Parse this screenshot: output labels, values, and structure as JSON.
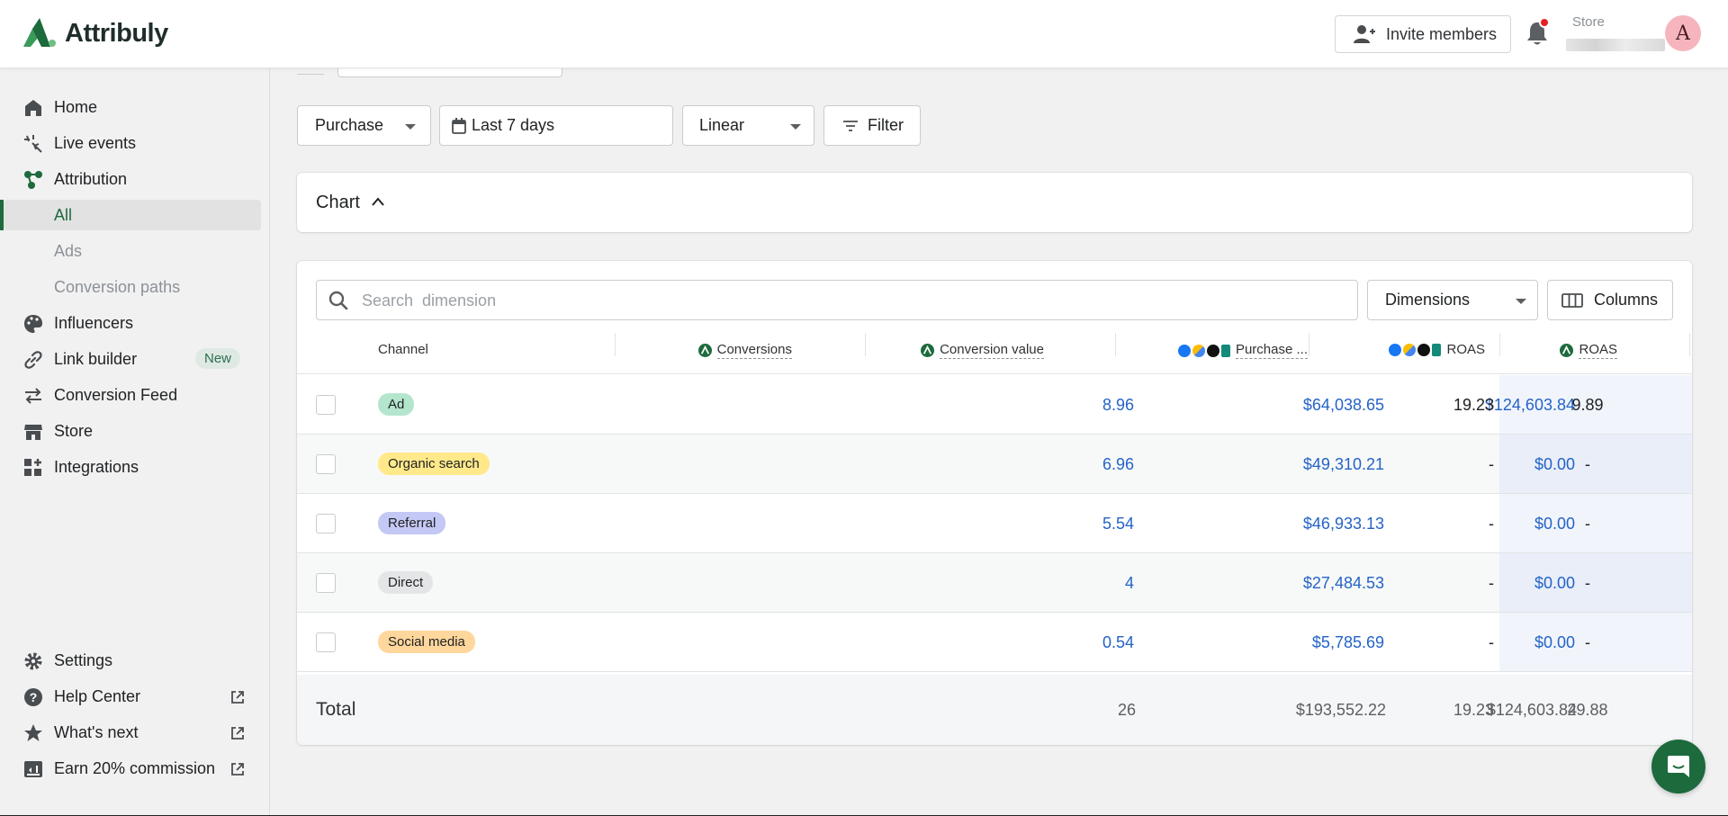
{
  "app": {
    "name": "Attribuly",
    "brand_color": "#1d6a3d"
  },
  "header": {
    "invite_label": "Invite members",
    "store_label": "Store",
    "avatar_letter": "A"
  },
  "sidebar": {
    "items": [
      {
        "label": "Home",
        "icon": "home-icon"
      },
      {
        "label": "Live events",
        "icon": "sparkle-icon"
      },
      {
        "label": "Attribution",
        "icon": "network-icon"
      },
      {
        "label": "All",
        "active": true
      },
      {
        "label": "Ads"
      },
      {
        "label": "Conversion paths"
      },
      {
        "label": "Influencers",
        "icon": "palette-icon"
      },
      {
        "label": "Link builder",
        "icon": "link-icon",
        "badge": "New"
      },
      {
        "label": "Conversion Feed",
        "icon": "arrows-icon"
      },
      {
        "label": "Store",
        "icon": "store-icon"
      },
      {
        "label": "Integrations",
        "icon": "grid-plus-icon"
      }
    ],
    "bottom": [
      {
        "label": "Settings",
        "icon": "gear-icon"
      },
      {
        "label": "Help Center",
        "icon": "help-icon",
        "external": true
      },
      {
        "label": "What's next",
        "icon": "star-icon",
        "external": true
      },
      {
        "label": "Earn 20% commission",
        "icon": "gift-icon",
        "external": true
      }
    ]
  },
  "filters": {
    "event": "Purchase",
    "date_range": "Last 7 days",
    "model": "Linear",
    "filter_label": "Filter"
  },
  "chart_section": {
    "title": "Chart"
  },
  "table": {
    "search_placeholder": "Search  dimension",
    "dimensions_label": "Dimensions",
    "columns_label": "Columns",
    "headers": {
      "channel": "Channel",
      "conversions": "Conversions",
      "conversion_value": "Conversion value",
      "purchase": "Purchase ...",
      "roas_platform": "ROAS",
      "roas": "ROAS"
    },
    "rows": [
      {
        "channel": "Ad",
        "pill_color": "#b4e6cd",
        "conversions": "8.96",
        "conversion_value": "$64,038.65",
        "purchase": "$124,603.84",
        "roas_platform": "19.23",
        "roas": "9.89"
      },
      {
        "channel": "Organic search",
        "pill_color": "#ffe98a",
        "conversions": "6.96",
        "conversion_value": "$49,310.21",
        "purchase": "$0.00",
        "roas_platform": "-",
        "roas": "-"
      },
      {
        "channel": "Referral",
        "pill_color": "#c4c8f5",
        "conversions": "5.54",
        "conversion_value": "$46,933.13",
        "purchase": "$0.00",
        "roas_platform": "-",
        "roas": "-"
      },
      {
        "channel": "Direct",
        "pill_color": "#e4e5e7",
        "conversions": "4",
        "conversion_value": "$27,484.53",
        "purchase": "$0.00",
        "roas_platform": "-",
        "roas": "-"
      },
      {
        "channel": "Social media",
        "pill_color": "#ffd79d",
        "conversions": "0.54",
        "conversion_value": "$5,785.69",
        "purchase": "$0.00",
        "roas_platform": "-",
        "roas": "-"
      }
    ],
    "total": {
      "label": "Total",
      "conversions": "26",
      "conversion_value": "$193,552.22",
      "purchase": "$124,603.84",
      "roas_platform": "19.23",
      "roas": "29.88"
    }
  }
}
